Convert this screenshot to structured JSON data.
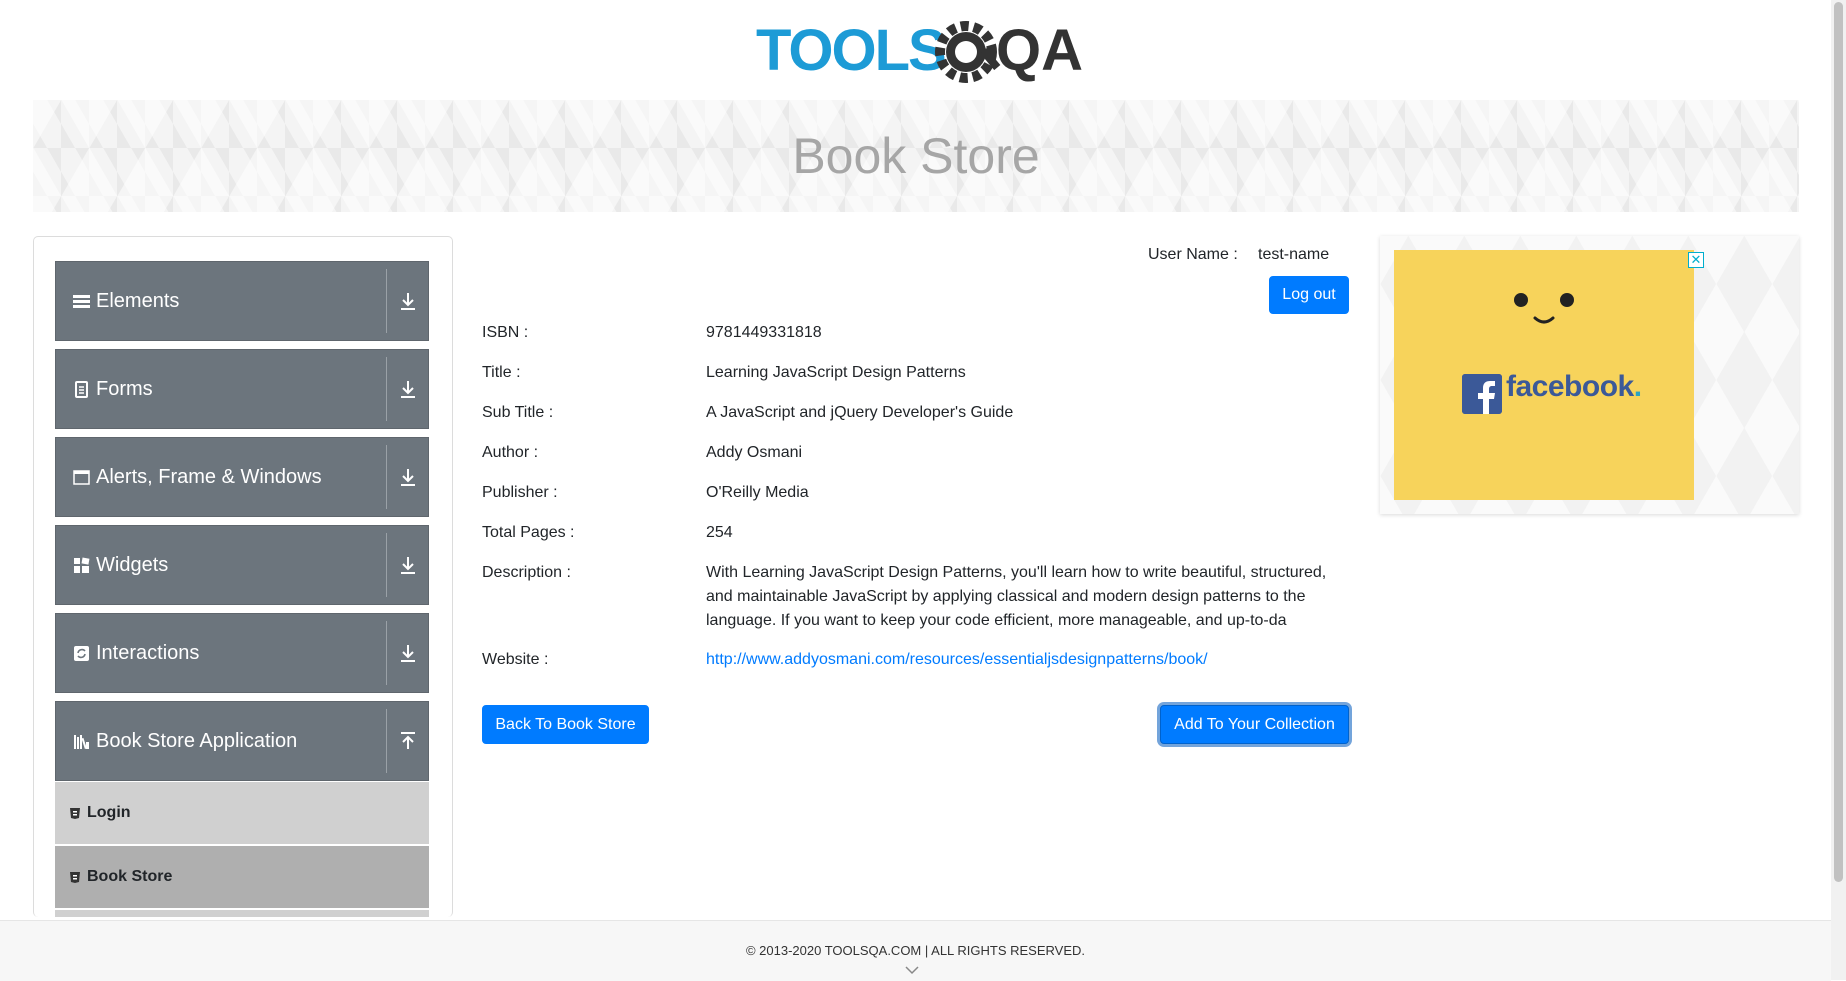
{
  "logo": {
    "text_left": "TOOLS",
    "text_right": "QA"
  },
  "banner": {
    "title": "Book Store"
  },
  "sidebar": {
    "groups": [
      {
        "label": "Elements",
        "icon": "hamburger-icon",
        "expanded": false
      },
      {
        "label": "Forms",
        "icon": "document-icon",
        "expanded": false
      },
      {
        "label": "Alerts, Frame & Windows",
        "icon": "window-icon",
        "expanded": false
      },
      {
        "label": "Widgets",
        "icon": "widgets-icon",
        "expanded": false
      },
      {
        "label": "Interactions",
        "icon": "refresh-icon",
        "expanded": false
      },
      {
        "label": "Book Store Application",
        "icon": "books-icon",
        "expanded": true
      }
    ],
    "items": [
      {
        "label": "Login"
      },
      {
        "label": "Book Store"
      }
    ]
  },
  "user": {
    "label": "User Name :",
    "value": "test-name",
    "logout_label": "Log out"
  },
  "book": {
    "rows": [
      {
        "label": "ISBN :",
        "value": "9781449331818"
      },
      {
        "label": "Title :",
        "value": "Learning JavaScript Design Patterns"
      },
      {
        "label": "Sub Title :",
        "value": "A JavaScript and jQuery Developer's Guide"
      },
      {
        "label": "Author :",
        "value": "Addy Osmani"
      },
      {
        "label": "Publisher :",
        "value": "O'Reilly Media"
      },
      {
        "label": "Total Pages :",
        "value": "254"
      },
      {
        "label": "Description :",
        "value": "With Learning JavaScript Design Patterns, you'll learn how to write beautiful, structured, and maintainable JavaScript by applying classical and modern design patterns to the language. If you want to keep your code efficient, more manageable, and up-to-da"
      },
      {
        "label": "Website :",
        "value": "http://www.addyosmani.com/resources/essentialjsdesignpatterns/book/"
      }
    ]
  },
  "actions": {
    "back_label": "Back To Book Store",
    "add_label": "Add To Your Collection"
  },
  "ad": {
    "close_glyph": "✕",
    "brand": "facebook",
    "brand_dot": "."
  },
  "footer": {
    "copyright": "© 2013-2020 TOOLSQA.COM | ALL RIGHTS RESERVED."
  },
  "colors": {
    "primary": "#007bff",
    "sidebar_bg": "#6c757d",
    "ad_bg": "#f7d35b",
    "facebook": "#3b5998",
    "logo_blue": "#1d9bd6"
  }
}
